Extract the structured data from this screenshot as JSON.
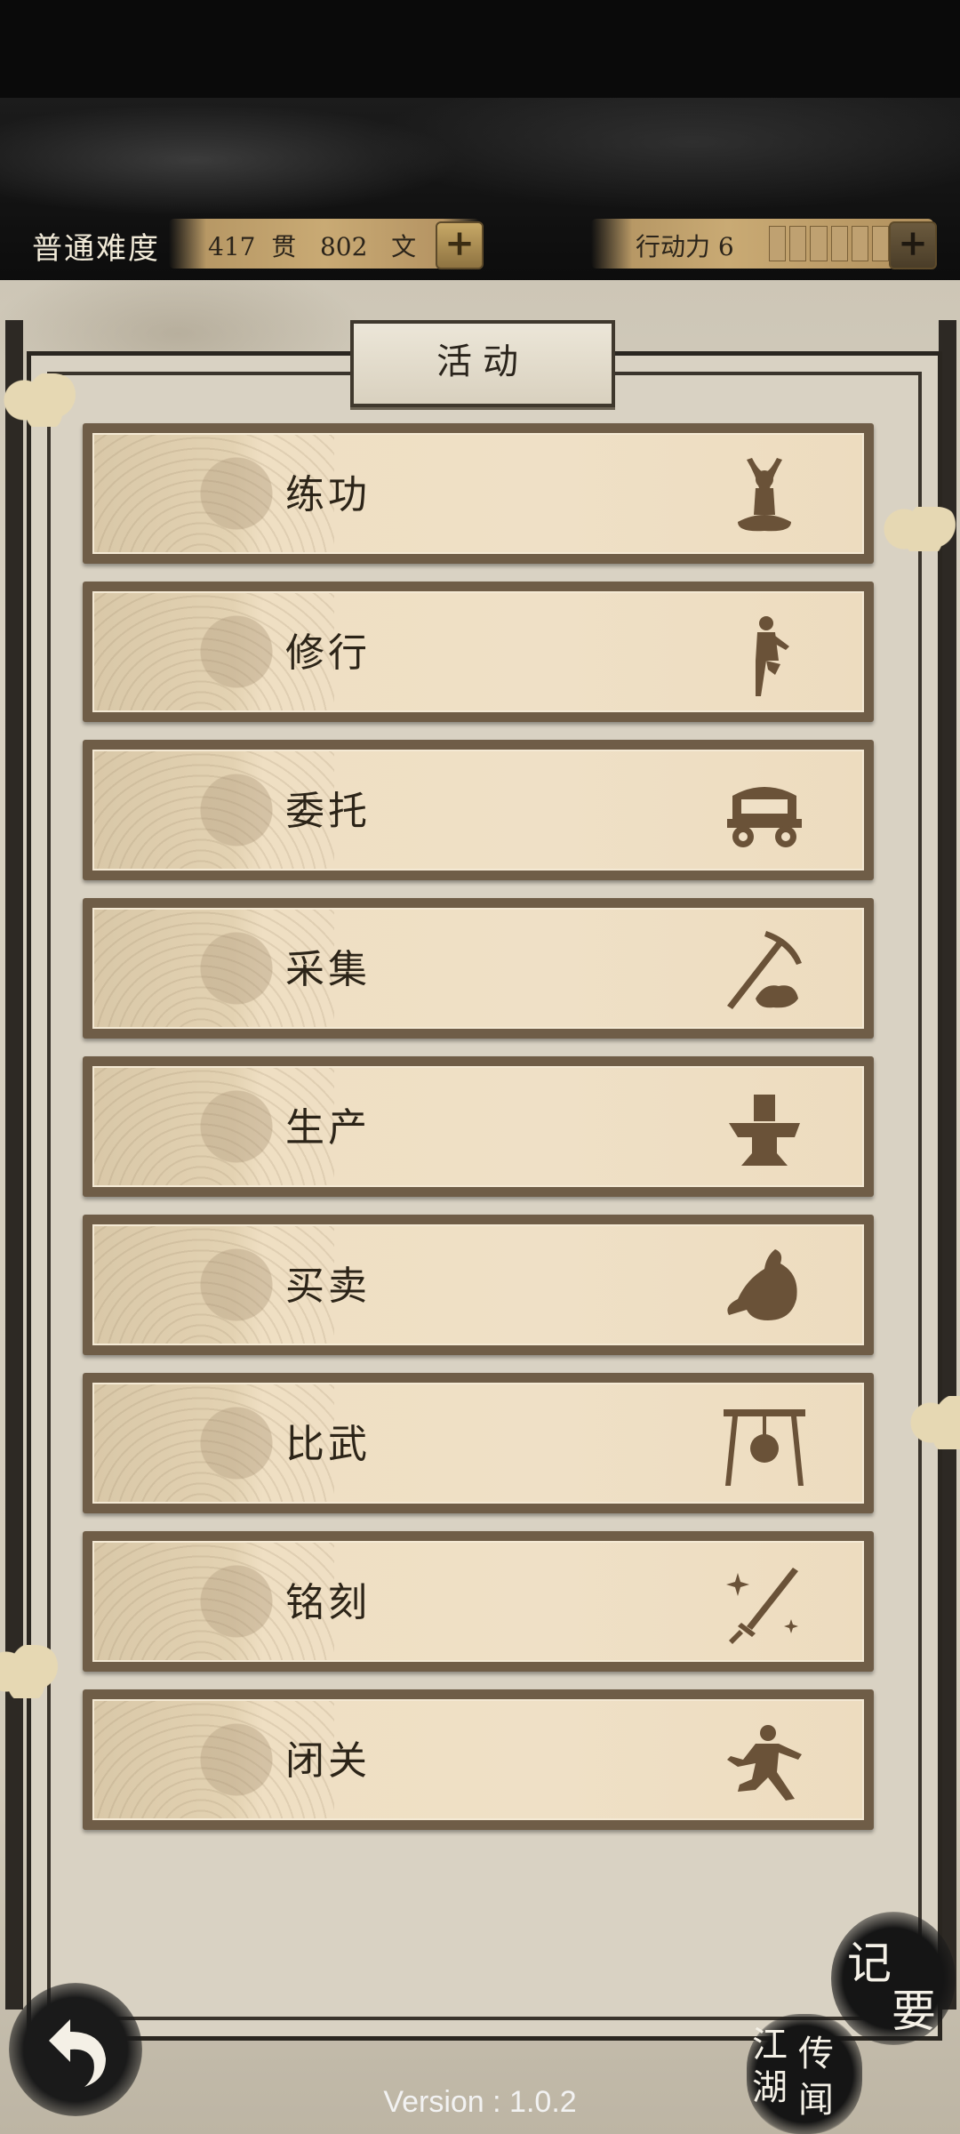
{
  "header": {
    "difficulty": "普通难度",
    "money_text": "417  贯   802   文",
    "action_label": "行动力 6",
    "action_points": 6
  },
  "panel": {
    "title": "活动"
  },
  "activities": [
    {
      "label": "练功",
      "icon": "meditation-icon"
    },
    {
      "label": "修行",
      "icon": "martial-stance-icon"
    },
    {
      "label": "委托",
      "icon": "cart-icon"
    },
    {
      "label": "采集",
      "icon": "pickaxe-icon"
    },
    {
      "label": "生产",
      "icon": "anvil-icon"
    },
    {
      "label": "买卖",
      "icon": "money-bag-icon"
    },
    {
      "label": "比武",
      "icon": "gong-icon"
    },
    {
      "label": "铭刻",
      "icon": "sword-sparkle-icon"
    },
    {
      "label": "闭关",
      "icon": "fighter-icon"
    }
  ],
  "bottom": {
    "memo": [
      "记",
      "要"
    ],
    "news": [
      "江",
      "湖",
      "传",
      "闻"
    ],
    "version": "Version : 1.0.2"
  },
  "colors": {
    "frame": "#6f5d47",
    "button_face": "#efe0c6",
    "ink": "#2c2418",
    "gold": "#c9aa74"
  }
}
